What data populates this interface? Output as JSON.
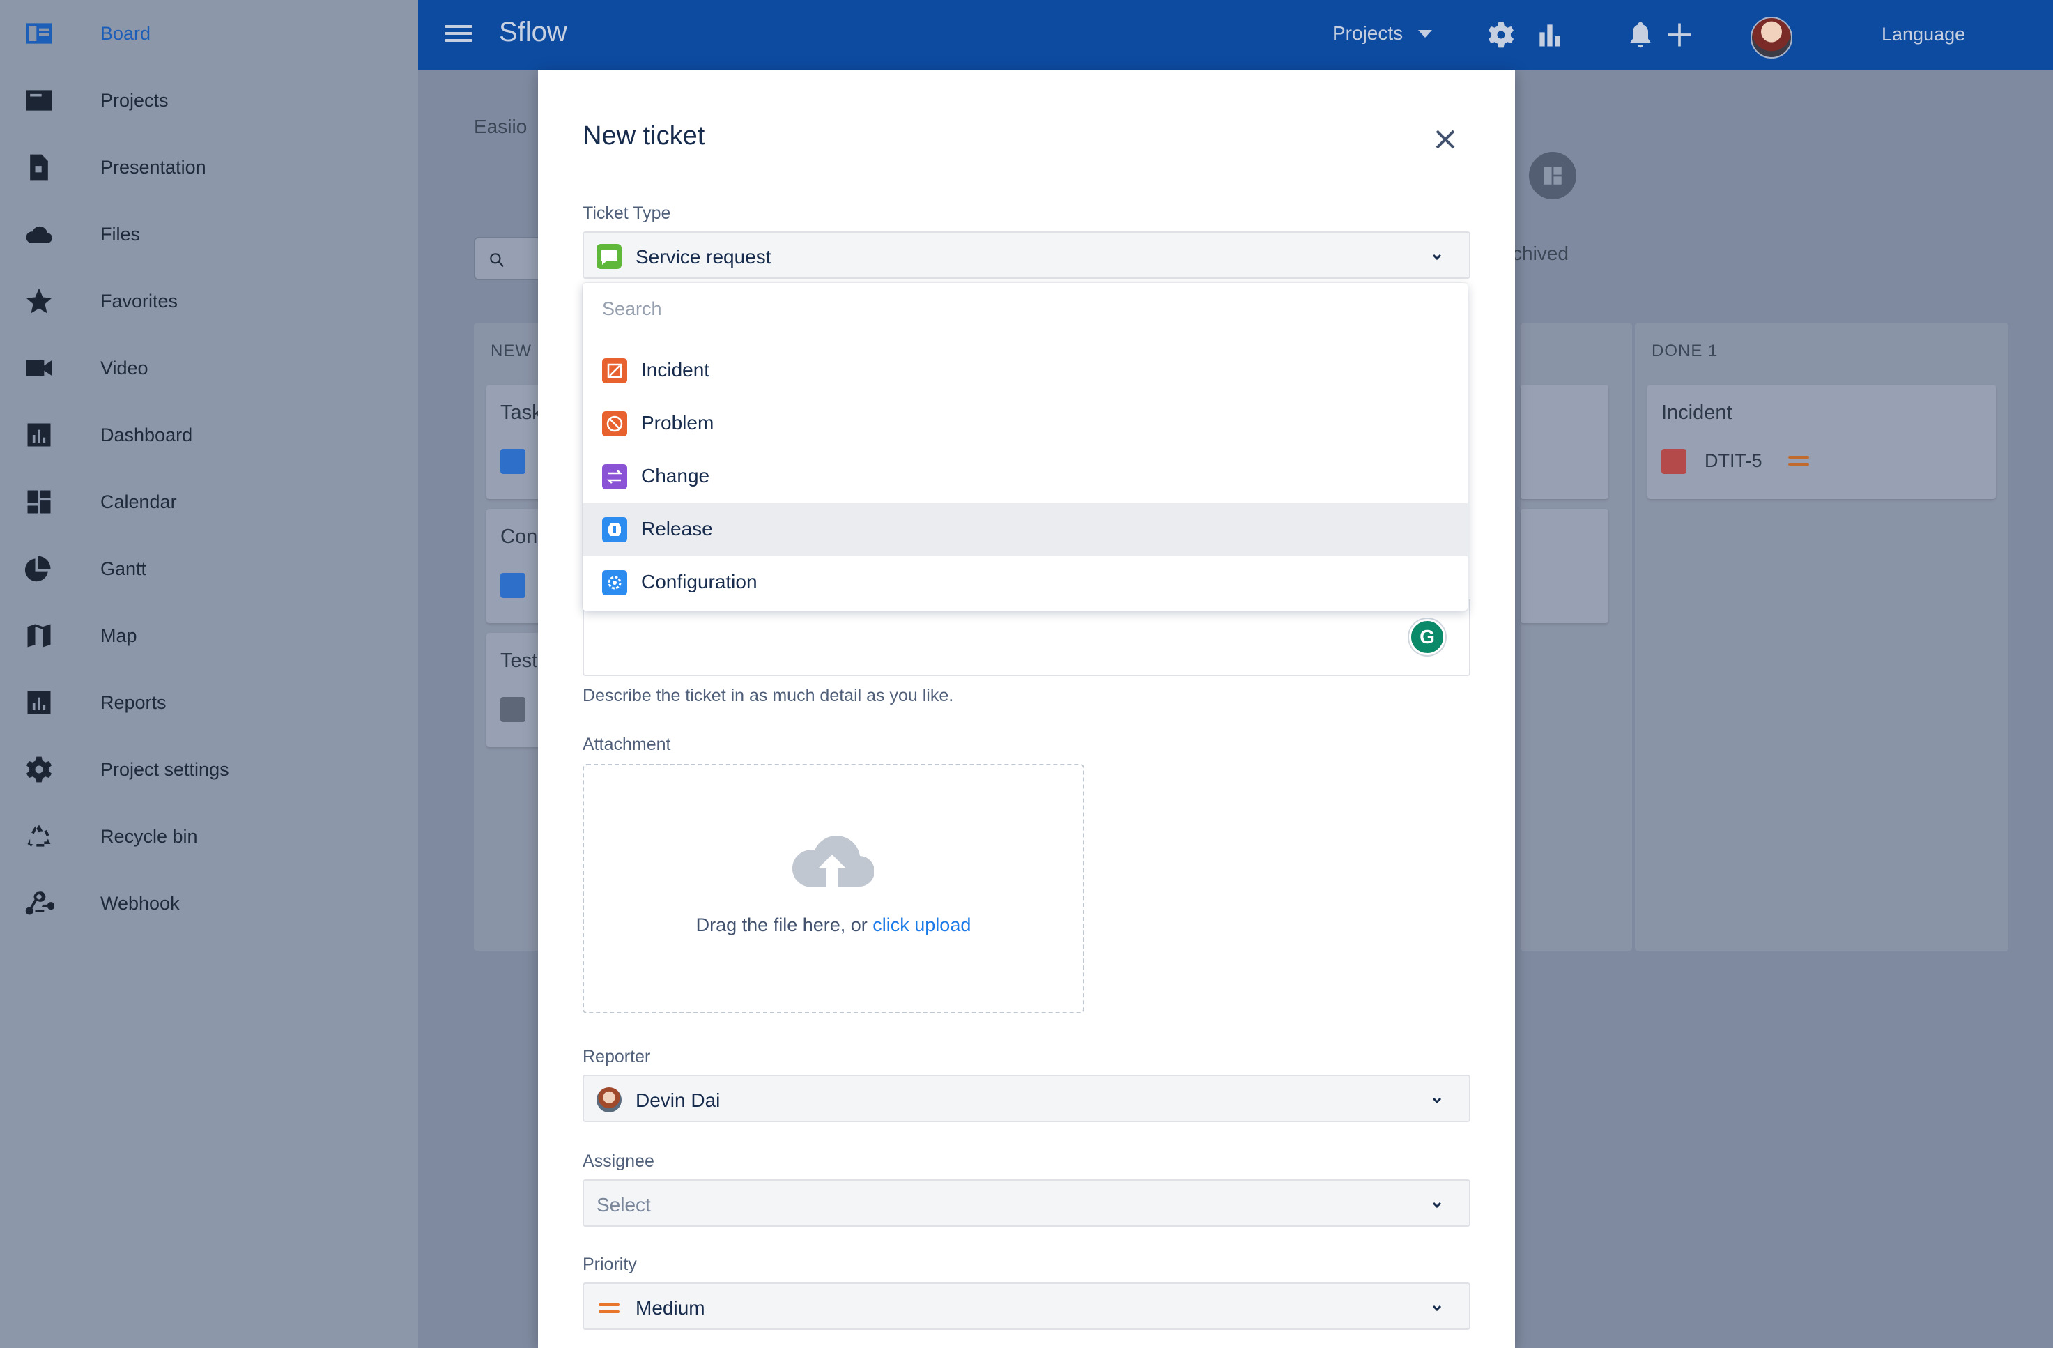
{
  "sidebar": {
    "items": [
      {
        "label": "Board",
        "icon": "board-icon"
      },
      {
        "label": "Projects",
        "icon": "projects-icon"
      },
      {
        "label": "Presentation",
        "icon": "presentation-icon"
      },
      {
        "label": "Files",
        "icon": "cloud-icon"
      },
      {
        "label": "Favorites",
        "icon": "star-icon"
      },
      {
        "label": "Video",
        "icon": "video-icon"
      },
      {
        "label": "Dashboard",
        "icon": "dashboard-icon"
      },
      {
        "label": "Calendar",
        "icon": "calendar-icon"
      },
      {
        "label": "Gantt",
        "icon": "gantt-icon"
      },
      {
        "label": "Map",
        "icon": "map-icon"
      },
      {
        "label": "Reports",
        "icon": "reports-icon"
      },
      {
        "label": "Project settings",
        "icon": "gear-icon"
      },
      {
        "label": "Recycle bin",
        "icon": "recycle-icon"
      },
      {
        "label": "Webhook",
        "icon": "webhook-icon"
      }
    ],
    "active_index": 0
  },
  "header": {
    "title": "Sflow",
    "projects_label": "Projects",
    "language_label": "Language"
  },
  "board": {
    "breadcrumb": "Easiio",
    "archived_label": "chived",
    "columns": [
      {
        "head": "NEW"
      },
      {
        "head": "DONE 1"
      }
    ],
    "cards": [
      "Task",
      "Con",
      "Test"
    ],
    "done_card": {
      "title": "Incident",
      "key": "DTIT-5"
    }
  },
  "modal": {
    "title": "New ticket",
    "ticket_type": {
      "label": "Ticket Type",
      "value": "Service request",
      "color": "#5fb83a"
    },
    "dropdown": {
      "search_placeholder": "Search",
      "options": [
        {
          "label": "Incident",
          "icon": "incident-icon",
          "color": "#e8622f"
        },
        {
          "label": "Problem",
          "icon": "problem-icon",
          "color": "#e8622f"
        },
        {
          "label": "Change",
          "icon": "change-icon",
          "color": "#8a53d6"
        },
        {
          "label": "Release",
          "icon": "release-icon",
          "color": "#2d8cf0"
        },
        {
          "label": "Configuration",
          "icon": "configuration-icon",
          "color": "#2d8cf0"
        }
      ],
      "highlighted_index": 3
    },
    "description_help": "Describe the ticket in as much detail as you like.",
    "attachment": {
      "label": "Attachment",
      "text": "Drag the file here, or",
      "link": "click upload"
    },
    "reporter": {
      "label": "Reporter",
      "value": "Devin Dai"
    },
    "assignee": {
      "label": "Assignee",
      "placeholder": "Select"
    },
    "priority": {
      "label": "Priority",
      "value": "Medium",
      "color": "#e7752b"
    }
  },
  "colors": {
    "header_bg": "#0d4ba1",
    "sidebar_active": "#1d5fb8",
    "link": "#1a7ae8"
  }
}
